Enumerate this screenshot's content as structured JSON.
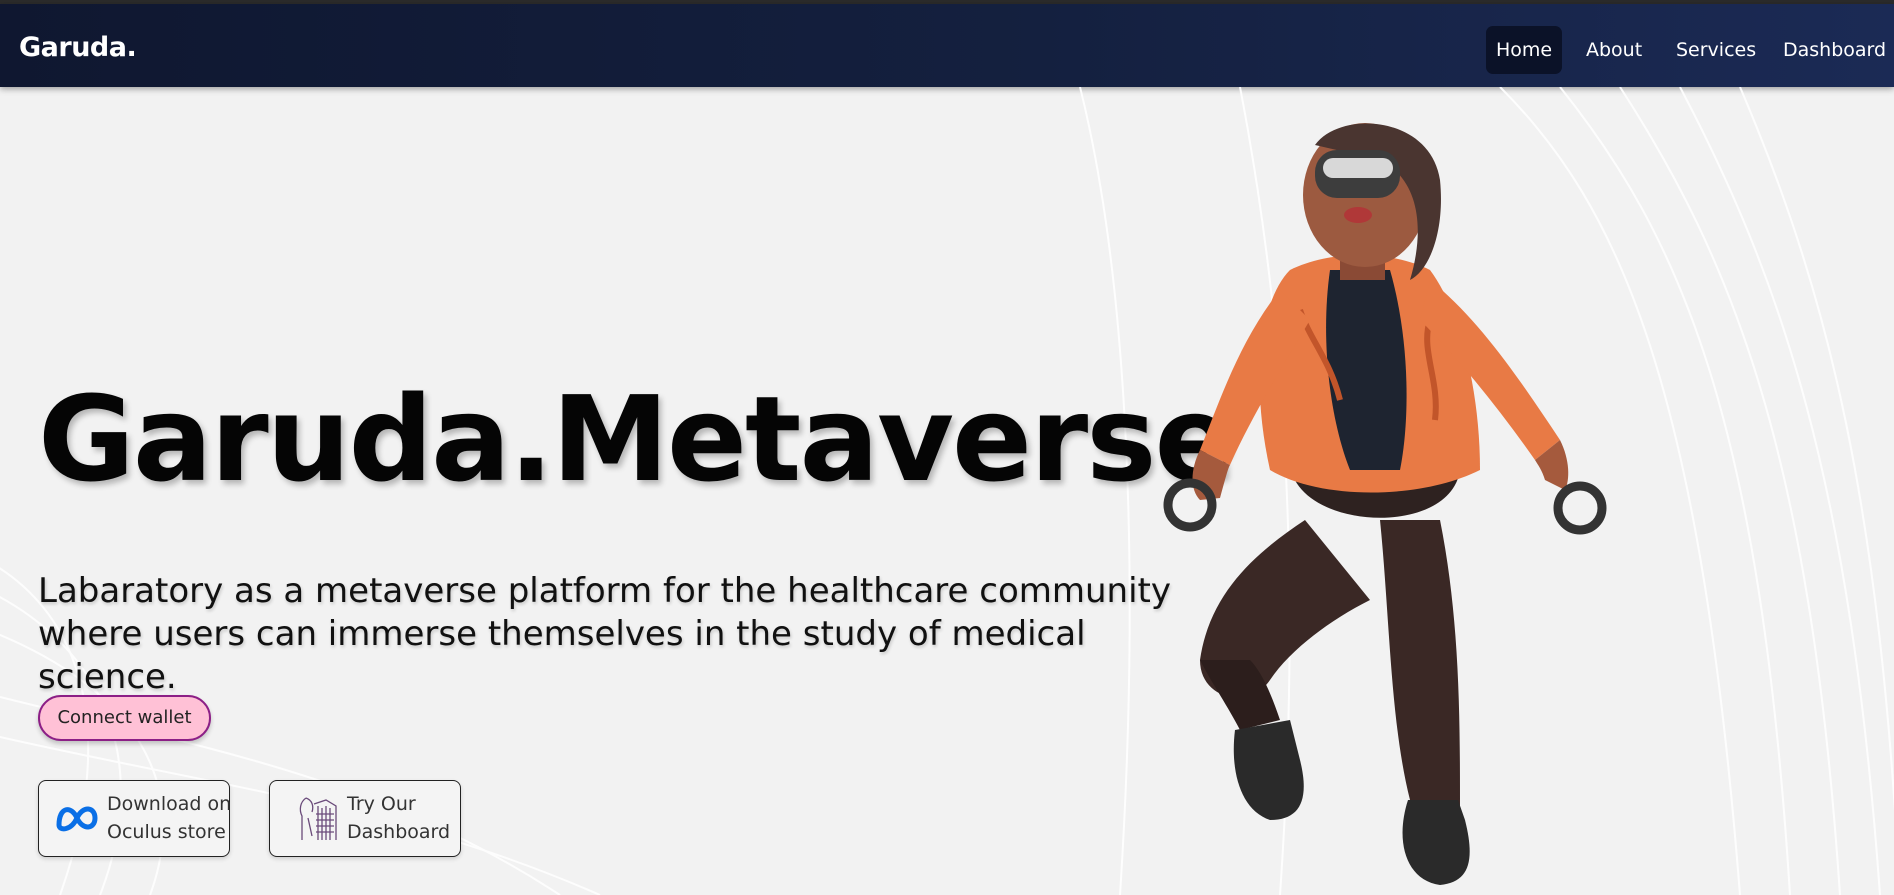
{
  "brand": "Garuda.",
  "nav": {
    "home": "Home",
    "about": "About",
    "services": "Services",
    "dashboard": "Dashboard"
  },
  "hero": {
    "title": "Garuda.Metaverse",
    "subtitle_line1": "Labaratory as a metaverse platform for the healthcare community",
    "subtitle_line2": "where users can immerse themselves in the study of medical science."
  },
  "actions": {
    "connect_wallet": "Connect wallet",
    "oculus_line1": "Download on",
    "oculus_line2": "Oculus store",
    "dash_line1": "Try Our",
    "dash_line2": "Dashboard"
  },
  "icons": {
    "oculus": "meta-logo-icon",
    "dashboard": "anatomy-body-icon",
    "figure": "vr-character-illustration"
  },
  "colors": {
    "nav_bg": "#0f1730",
    "connect_bg": "#ffc1d6",
    "connect_border": "#8c1f86",
    "meta_blue": "#0a6fe6"
  }
}
